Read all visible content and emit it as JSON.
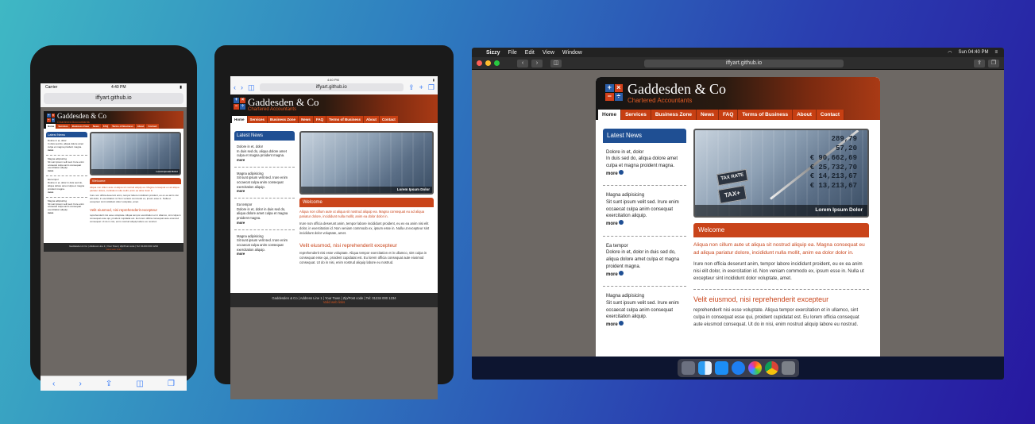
{
  "site": {
    "company": "Gaddesden & Co",
    "tagline": "Chartered Accountants",
    "logo_symbols": [
      "+",
      "×",
      "−",
      "÷"
    ],
    "nav": [
      "Home",
      "Services",
      "Business Zone",
      "News",
      "FAQ",
      "Terms of Business",
      "About",
      "Contact"
    ],
    "latest_news_heading": "Latest News",
    "news": [
      {
        "title": "Dolore in et, dolor",
        "body": "In duis sed do, aliqua dolore amet culpa et magna proident magna.",
        "more": "more"
      },
      {
        "title": "Magna adipisicing",
        "body": "Sit sunt ipsum velit sed. Irure enim occaecat culpa anim consequat exercitation aliquip.",
        "more": "more"
      },
      {
        "title": "Ea tempor",
        "body": "Dolore in et, dolor in duis sed do, aliqua dolore amet culpa et magna proident magna.",
        "more": "more"
      },
      {
        "title": "Magna adipisicing",
        "body": "Sit sunt ipsum velit sed. Irure enim occaecat culpa anim consequat exercitation aliquip.",
        "more": "more"
      }
    ],
    "photo_caption": "Lorem Ipsum Dolor",
    "photo_numbers": [
      "289,79",
      "57,20",
      "€ 90,662,69",
      "€ 25,732,70",
      "€ 14,213,67",
      "€ 13,213,67"
    ],
    "photo_key_labels": [
      "TAX RATE",
      "TAX+"
    ],
    "welcome_heading": "Welcome",
    "welcome_red": "Aliqua non cillum aute ut aliqua sit nostrud aliquip ea. Magna consequat eu ad aliqua pariatur dolore, incididunt nulla mollit, anim ea dolor dolor in.",
    "welcome_body": "Irure non officia deserunt anim, tempor labore incididunt proident, eu ex ea anim nisi elit dolor, in exercitation id. Non veniam commodo ex, ipsum esse in. Nulla ut excepteur sint incididunt dolor voluptate, amet.",
    "section2_heading": "Velit eiusmod, nisi reprehenderit excepteur",
    "section2_body": "reprehenderit nisi esse voluptate. Aliqua tempor exercitation et in ullamco, sint culpa in consequat esse qui, proident cupidatat est. Eu lorem officia consequat aute eiusmod consequat. Ut do in nisi, enim nostrud aliquip labore eu nostrud.",
    "footer": "Gaddesden & Co  |  Address Line 1  |  Your Town  |  Zip/Post code  |  Tel: 01234 000 1234",
    "footer_link": "Valid web links"
  },
  "phone": {
    "carrier": "Carrier",
    "time": "4:40 PM",
    "url": "iffyart.github.io",
    "toolbar_icons": [
      "back-icon",
      "forward-icon",
      "share-icon",
      "bookmarks-icon",
      "tabs-icon"
    ]
  },
  "tablet": {
    "time": "4:40 PM",
    "url": "iffyart.github.io"
  },
  "desktop": {
    "menu": [
      "Sizzy",
      "File",
      "Edit",
      "View",
      "Window"
    ],
    "clock": "Sun 04:40 PM",
    "url": "iffyart.github.io",
    "dock_icons": [
      "launchpad-icon",
      "finder-icon",
      "appstore-icon",
      "safari-icon",
      "photos-icon",
      "chrome-icon",
      "preferences-icon"
    ]
  },
  "colors": {
    "accent_orange": "#c9441a",
    "news_blue": "#1f4f93",
    "bg_start": "#3fb8c4",
    "bg_end": "#2718a0"
  }
}
